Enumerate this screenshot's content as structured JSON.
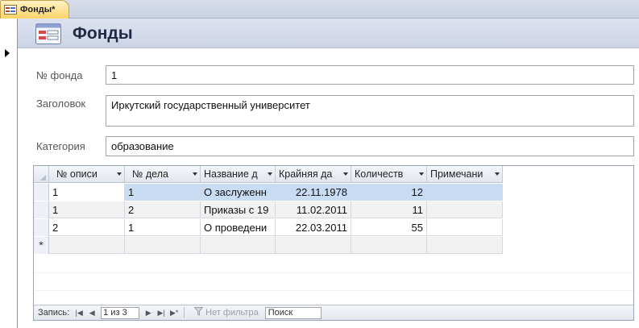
{
  "tab": {
    "label": "Фонды*",
    "icon": "form-icon"
  },
  "header": {
    "title": "Фонды",
    "icon": "form-icon"
  },
  "form": {
    "fund_no": {
      "label": "№ фонда",
      "value": "1"
    },
    "title": {
      "label": "Заголовок",
      "value": "Иркутский государственный университет"
    },
    "category": {
      "label": "Категория",
      "value": "образование"
    }
  },
  "datasheet": {
    "columns": [
      "№ описи",
      "№ дела",
      "Название д",
      "Крайняя да",
      "Количеств",
      "Примечани"
    ],
    "rows": [
      [
        "1",
        "1",
        "О заслуженн",
        "22.11.1978",
        "12",
        ""
      ],
      [
        "1",
        "2",
        "Приказы с 19",
        "11.02.2011",
        "11",
        ""
      ],
      [
        "2",
        "1",
        "О проведени",
        "22.03.2011",
        "55",
        ""
      ]
    ],
    "new_row_marker": "*"
  },
  "navigation": {
    "record_label": "Запись:",
    "position": "1 из 3",
    "filter_label": "Нет фильтра",
    "search_placeholder": "Поиск"
  }
}
